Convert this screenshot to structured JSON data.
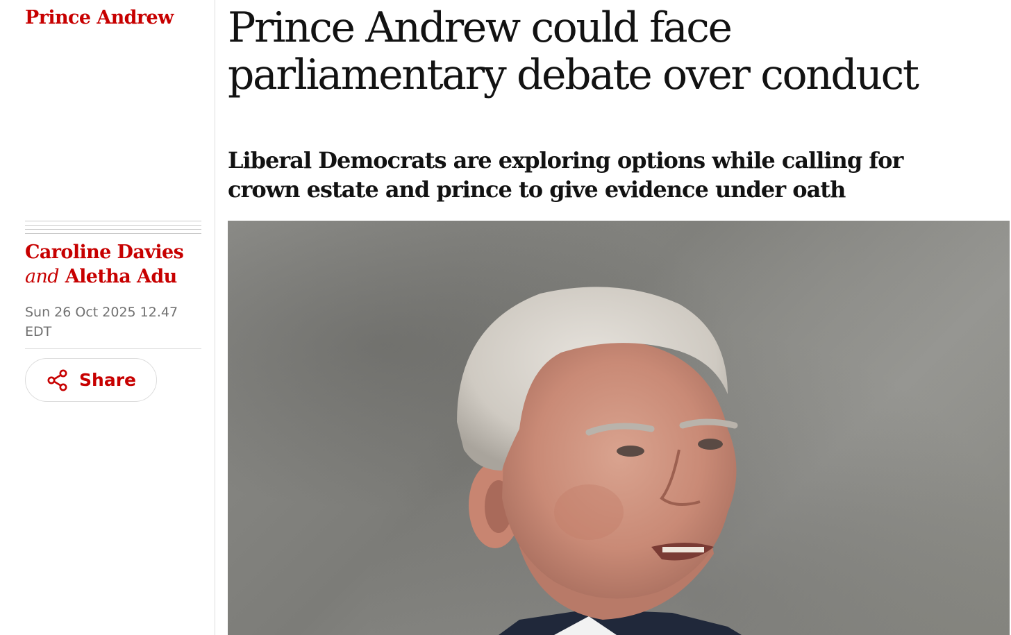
{
  "section": {
    "label": "Prince Andrew",
    "color": "#c70000"
  },
  "article": {
    "headline": "Prince Andrew could face parliamentary debate over conduct",
    "standfirst": "Liberal Democrats are exploring options while calling for crown estate and prince to give evidence under oath",
    "authors": {
      "first": "Caroline Davies",
      "conjunction": "and",
      "second": "Aletha Adu"
    },
    "dateline": "Sun 26 Oct 2025 12.47 EDT"
  },
  "share": {
    "label": "Share",
    "icon": "share-icon"
  },
  "photo": {
    "subject": "man-portrait"
  }
}
